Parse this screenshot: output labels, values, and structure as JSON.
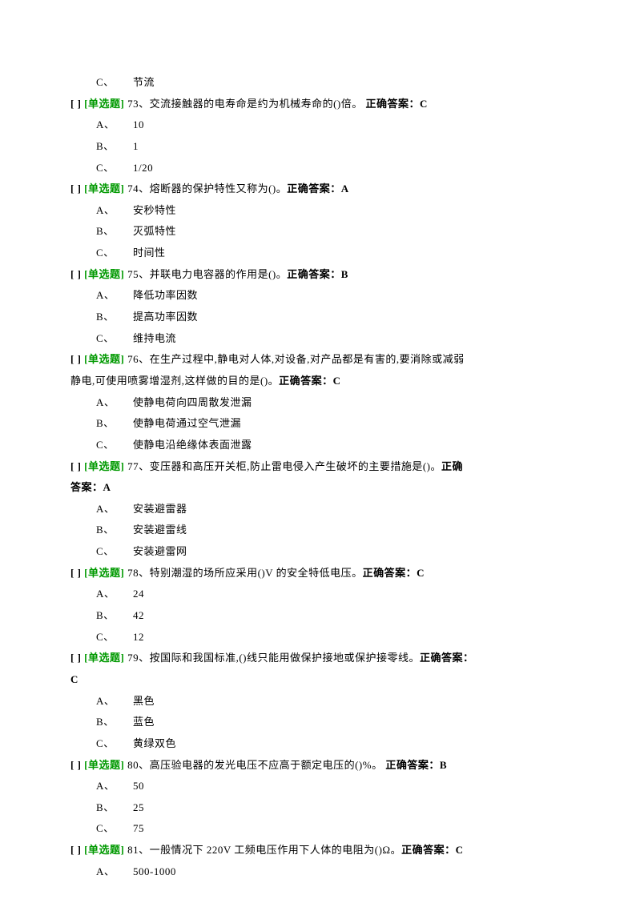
{
  "bracket_text": "[   ]",
  "tag_text": "[单选题]",
  "answer_prefix": "正确答案：",
  "leading_option": {
    "letter": "C、",
    "text": "节流"
  },
  "questions": [
    {
      "num": "73、",
      "text": "交流接触器的电寿命是约为机械寿命的()倍。  ",
      "answer": "C",
      "options": [
        {
          "letter": "A、",
          "text": "10"
        },
        {
          "letter": "B、",
          "text": "1"
        },
        {
          "letter": "C、",
          "text": "1/20"
        }
      ]
    },
    {
      "num": "74、",
      "text": "熔断器的保护特性又称为()。",
      "answer": "A",
      "options": [
        {
          "letter": "A、",
          "text": "安秒特性"
        },
        {
          "letter": "B、",
          "text": "灭弧特性"
        },
        {
          "letter": "C、",
          "text": "时间性"
        }
      ]
    },
    {
      "num": "75、",
      "text": "并联电力电容器的作用是()。",
      "answer": "B",
      "options": [
        {
          "letter": "A、",
          "text": "降低功率因数"
        },
        {
          "letter": "B、",
          "text": "提高功率因数"
        },
        {
          "letter": "C、",
          "text": "维持电流"
        }
      ]
    },
    {
      "num": "76、",
      "text": "在生产过程中,静电对人体,对设备,对产品都是有害的,要消除或减弱",
      "cont": "静电,可使用喷雾增湿剂,这样做的目的是()。",
      "answer": "C",
      "options": [
        {
          "letter": "A、",
          "text": "使静电荷向四周散发泄漏"
        },
        {
          "letter": "B、",
          "text": "使静电荷通过空气泄漏"
        },
        {
          "letter": "C、",
          "text": "使静电沿绝缘体表面泄露"
        }
      ]
    },
    {
      "num": "77、",
      "text": "变压器和高压开关柜,防止雷电侵入产生破坏的主要措施是()。",
      "answer": "A",
      "answer_wrap": true,
      "options": [
        {
          "letter": "A、",
          "text": "安装避雷器"
        },
        {
          "letter": "B、",
          "text": "安装避雷线"
        },
        {
          "letter": "C、",
          "text": "安装避雷网"
        }
      ]
    },
    {
      "num": "78、",
      "text": "特别潮湿的场所应采用()V 的安全特低电压。",
      "answer": "C",
      "options": [
        {
          "letter": "A、",
          "text": "24"
        },
        {
          "letter": "B、",
          "text": "42"
        },
        {
          "letter": "C、",
          "text": "12"
        }
      ]
    },
    {
      "num": "79、",
      "text": "按国际和我国标准,()线只能用做保护接地或保护接零线。",
      "answer": "C",
      "answer_wrap": true,
      "answer_alone": true,
      "options": [
        {
          "letter": "A、",
          "text": "黑色"
        },
        {
          "letter": "B、",
          "text": "蓝色"
        },
        {
          "letter": "C、",
          "text": "黄绿双色"
        }
      ]
    },
    {
      "num": "80、",
      "text": "高压验电器的发光电压不应高于额定电压的()%。 ",
      "answer": "B",
      "options": [
        {
          "letter": "A、",
          "text": "50"
        },
        {
          "letter": "B、",
          "text": "25"
        },
        {
          "letter": "C、",
          "text": "75"
        }
      ]
    },
    {
      "num": "81、",
      "text": "一般情况下 220V 工频电压作用下人体的电阻为()Ω。",
      "answer": "C",
      "options": [
        {
          "letter": "A、",
          "text": "500-1000"
        }
      ]
    }
  ]
}
